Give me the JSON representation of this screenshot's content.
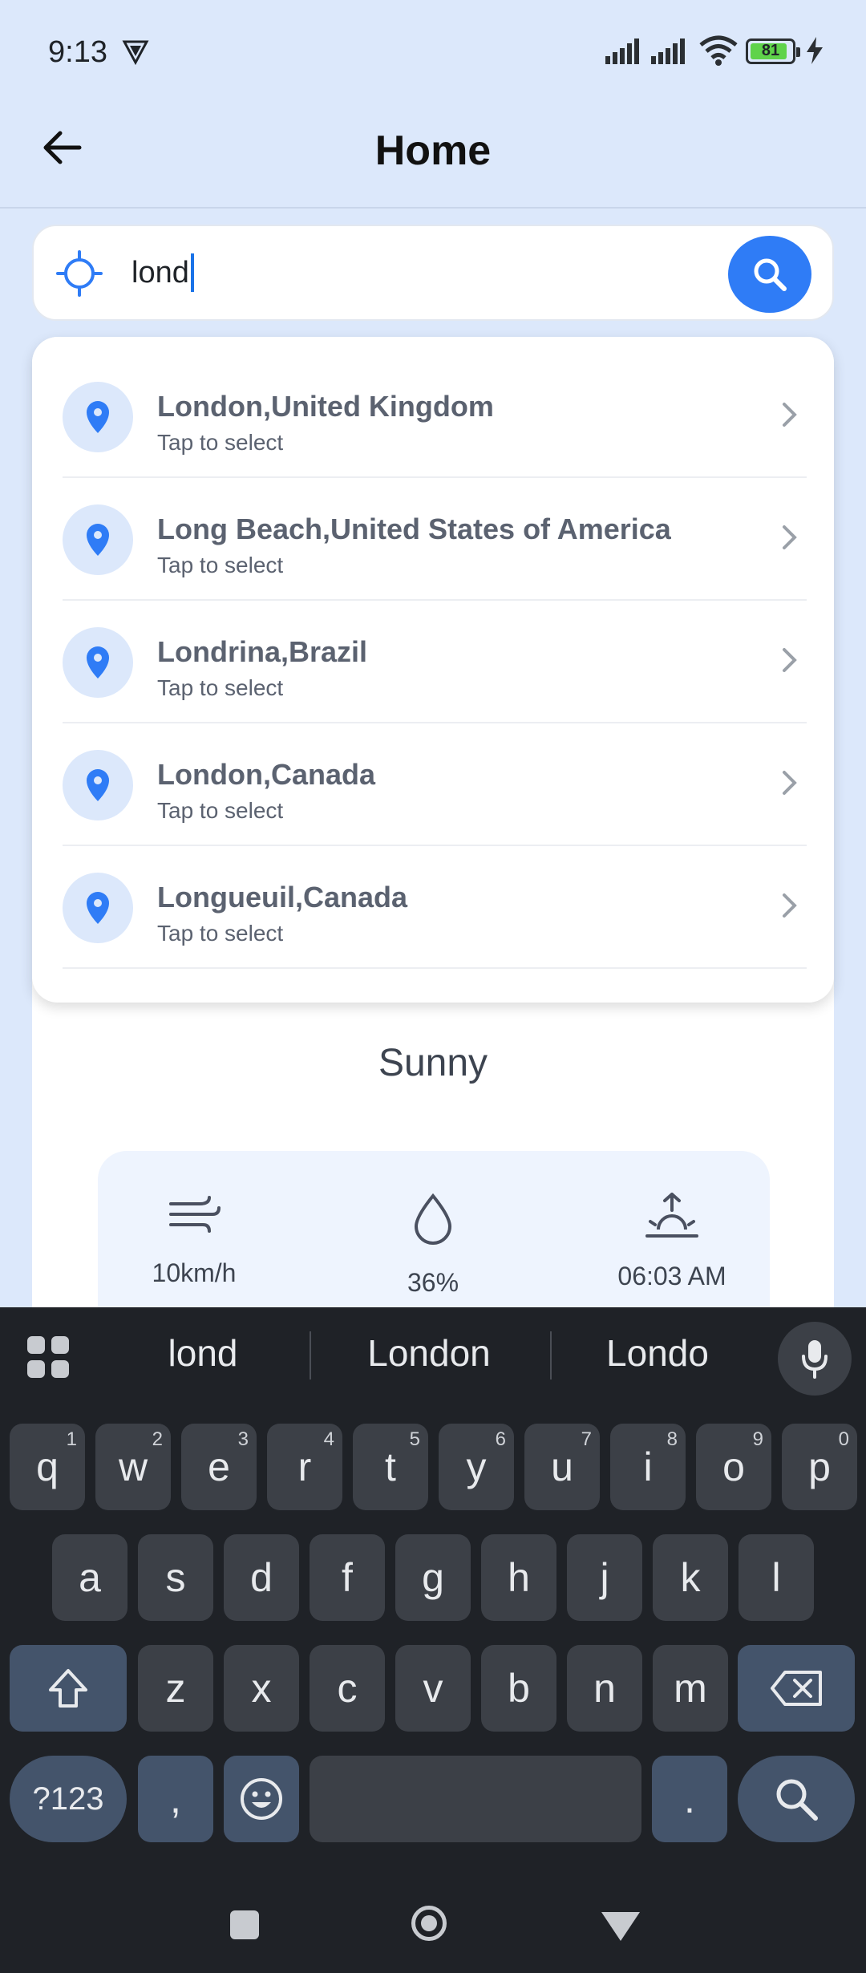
{
  "status_bar": {
    "time": "9:13",
    "battery": "81"
  },
  "app_bar": {
    "title": "Home"
  },
  "search": {
    "query": "lond"
  },
  "suggestions": [
    {
      "name": "London,United Kingdom",
      "sub": "Tap to select"
    },
    {
      "name": "Long Beach,United States of America",
      "sub": "Tap to select"
    },
    {
      "name": "Londrina,Brazil",
      "sub": "Tap to select"
    },
    {
      "name": "London,Canada",
      "sub": "Tap to select"
    },
    {
      "name": "Longueuil,Canada",
      "sub": "Tap to select"
    }
  ],
  "weather": {
    "condition": "Sunny",
    "wind": "10km/h",
    "humidity": "36%",
    "sunrise": "06:03 AM"
  },
  "keyboard": {
    "suggestions": [
      "lond",
      "London",
      "Londo"
    ],
    "row1": [
      {
        "k": "q",
        "h": "1"
      },
      {
        "k": "w",
        "h": "2"
      },
      {
        "k": "e",
        "h": "3"
      },
      {
        "k": "r",
        "h": "4"
      },
      {
        "k": "t",
        "h": "5"
      },
      {
        "k": "y",
        "h": "6"
      },
      {
        "k": "u",
        "h": "7"
      },
      {
        "k": "i",
        "h": "8"
      },
      {
        "k": "o",
        "h": "9"
      },
      {
        "k": "p",
        "h": "0"
      }
    ],
    "row2": [
      "a",
      "s",
      "d",
      "f",
      "g",
      "h",
      "j",
      "k",
      "l"
    ],
    "row3": [
      "z",
      "x",
      "c",
      "v",
      "b",
      "n",
      "m"
    ],
    "symbols_label": "?123",
    "comma": ",",
    "period": "."
  },
  "colors": {
    "accent": "#2f7cf6",
    "header_bg": "#dce8fb",
    "keyboard_bg": "#1f2227"
  }
}
